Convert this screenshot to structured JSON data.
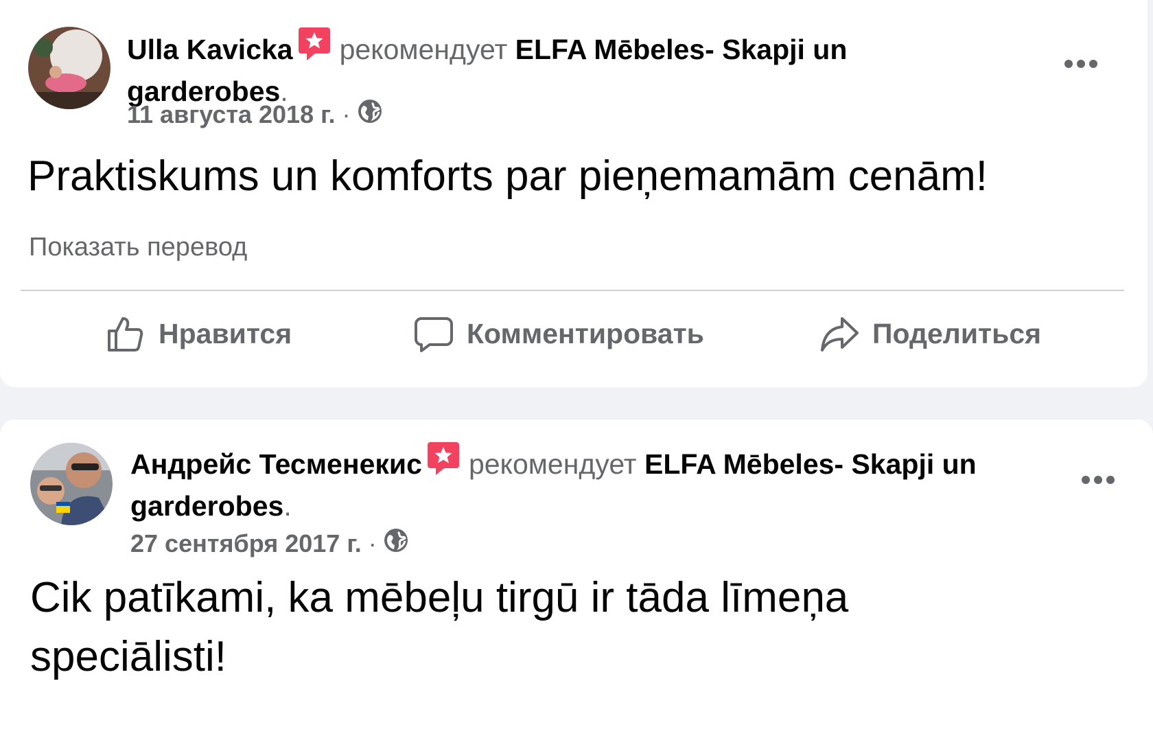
{
  "colors": {
    "background": "#f0f2f5",
    "card": "#ffffff",
    "primary_text": "#050505",
    "secondary_text": "#65676b",
    "recommend_badge": "#f3425f",
    "divider": "#ced0d4"
  },
  "posts": [
    {
      "author": "Ulla Kavicka",
      "badge_icon": "recommend-star-badge-icon",
      "verb": "рекомендует",
      "page": "ELFA Mēbeles- Skapji un garderobes",
      "period": ".",
      "date": "11 августа 2018 г.",
      "separator": "·",
      "privacy_icon": "globe-icon",
      "text": "Praktiskums un komforts par pieņemamām cenām!",
      "translate_link": "Показать перевод",
      "actions": {
        "like": "Нравится",
        "comment": "Комментировать",
        "share": "Поделиться"
      }
    },
    {
      "author": "Андрейс Тесменекис",
      "badge_icon": "recommend-star-badge-icon",
      "verb": "рекомендует",
      "page": "ELFA Mēbeles- Skapji un garderobes",
      "period": ".",
      "date": "27 сентября 2017 г.",
      "separator": "·",
      "privacy_icon": "globe-icon",
      "text_line1": "Cik patīkami, ka mēbeļu tirgū ir tāda līmeņa",
      "text_line2": "speciālisti!"
    }
  ]
}
